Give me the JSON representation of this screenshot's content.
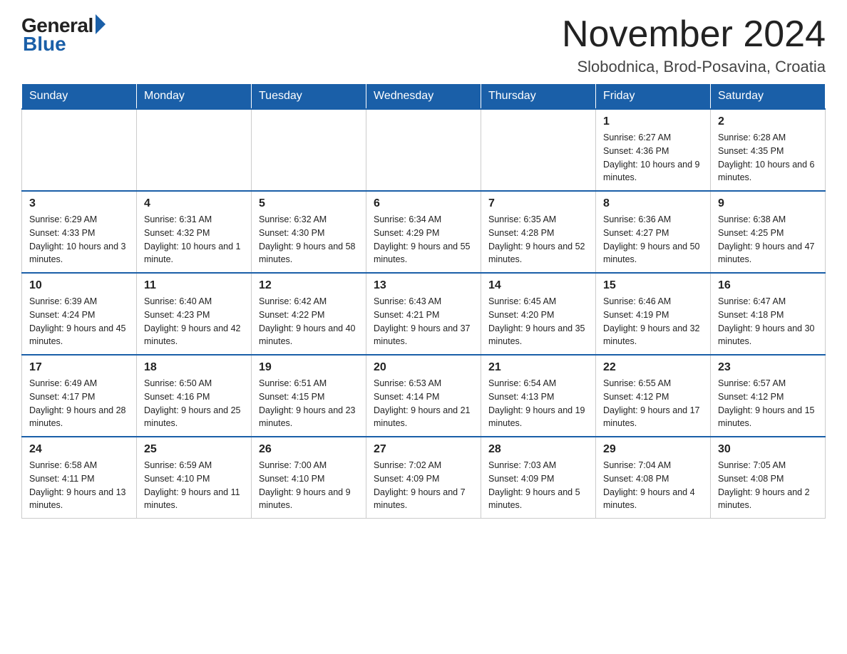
{
  "logo": {
    "general": "General",
    "blue": "Blue"
  },
  "title": "November 2024",
  "location": "Slobodnica, Brod-Posavina, Croatia",
  "days_of_week": [
    "Sunday",
    "Monday",
    "Tuesday",
    "Wednesday",
    "Thursday",
    "Friday",
    "Saturday"
  ],
  "weeks": [
    [
      {
        "day": "",
        "info": ""
      },
      {
        "day": "",
        "info": ""
      },
      {
        "day": "",
        "info": ""
      },
      {
        "day": "",
        "info": ""
      },
      {
        "day": "",
        "info": ""
      },
      {
        "day": "1",
        "info": "Sunrise: 6:27 AM\nSunset: 4:36 PM\nDaylight: 10 hours and 9 minutes."
      },
      {
        "day": "2",
        "info": "Sunrise: 6:28 AM\nSunset: 4:35 PM\nDaylight: 10 hours and 6 minutes."
      }
    ],
    [
      {
        "day": "3",
        "info": "Sunrise: 6:29 AM\nSunset: 4:33 PM\nDaylight: 10 hours and 3 minutes."
      },
      {
        "day": "4",
        "info": "Sunrise: 6:31 AM\nSunset: 4:32 PM\nDaylight: 10 hours and 1 minute."
      },
      {
        "day": "5",
        "info": "Sunrise: 6:32 AM\nSunset: 4:30 PM\nDaylight: 9 hours and 58 minutes."
      },
      {
        "day": "6",
        "info": "Sunrise: 6:34 AM\nSunset: 4:29 PM\nDaylight: 9 hours and 55 minutes."
      },
      {
        "day": "7",
        "info": "Sunrise: 6:35 AM\nSunset: 4:28 PM\nDaylight: 9 hours and 52 minutes."
      },
      {
        "day": "8",
        "info": "Sunrise: 6:36 AM\nSunset: 4:27 PM\nDaylight: 9 hours and 50 minutes."
      },
      {
        "day": "9",
        "info": "Sunrise: 6:38 AM\nSunset: 4:25 PM\nDaylight: 9 hours and 47 minutes."
      }
    ],
    [
      {
        "day": "10",
        "info": "Sunrise: 6:39 AM\nSunset: 4:24 PM\nDaylight: 9 hours and 45 minutes."
      },
      {
        "day": "11",
        "info": "Sunrise: 6:40 AM\nSunset: 4:23 PM\nDaylight: 9 hours and 42 minutes."
      },
      {
        "day": "12",
        "info": "Sunrise: 6:42 AM\nSunset: 4:22 PM\nDaylight: 9 hours and 40 minutes."
      },
      {
        "day": "13",
        "info": "Sunrise: 6:43 AM\nSunset: 4:21 PM\nDaylight: 9 hours and 37 minutes."
      },
      {
        "day": "14",
        "info": "Sunrise: 6:45 AM\nSunset: 4:20 PM\nDaylight: 9 hours and 35 minutes."
      },
      {
        "day": "15",
        "info": "Sunrise: 6:46 AM\nSunset: 4:19 PM\nDaylight: 9 hours and 32 minutes."
      },
      {
        "day": "16",
        "info": "Sunrise: 6:47 AM\nSunset: 4:18 PM\nDaylight: 9 hours and 30 minutes."
      }
    ],
    [
      {
        "day": "17",
        "info": "Sunrise: 6:49 AM\nSunset: 4:17 PM\nDaylight: 9 hours and 28 minutes."
      },
      {
        "day": "18",
        "info": "Sunrise: 6:50 AM\nSunset: 4:16 PM\nDaylight: 9 hours and 25 minutes."
      },
      {
        "day": "19",
        "info": "Sunrise: 6:51 AM\nSunset: 4:15 PM\nDaylight: 9 hours and 23 minutes."
      },
      {
        "day": "20",
        "info": "Sunrise: 6:53 AM\nSunset: 4:14 PM\nDaylight: 9 hours and 21 minutes."
      },
      {
        "day": "21",
        "info": "Sunrise: 6:54 AM\nSunset: 4:13 PM\nDaylight: 9 hours and 19 minutes."
      },
      {
        "day": "22",
        "info": "Sunrise: 6:55 AM\nSunset: 4:12 PM\nDaylight: 9 hours and 17 minutes."
      },
      {
        "day": "23",
        "info": "Sunrise: 6:57 AM\nSunset: 4:12 PM\nDaylight: 9 hours and 15 minutes."
      }
    ],
    [
      {
        "day": "24",
        "info": "Sunrise: 6:58 AM\nSunset: 4:11 PM\nDaylight: 9 hours and 13 minutes."
      },
      {
        "day": "25",
        "info": "Sunrise: 6:59 AM\nSunset: 4:10 PM\nDaylight: 9 hours and 11 minutes."
      },
      {
        "day": "26",
        "info": "Sunrise: 7:00 AM\nSunset: 4:10 PM\nDaylight: 9 hours and 9 minutes."
      },
      {
        "day": "27",
        "info": "Sunrise: 7:02 AM\nSunset: 4:09 PM\nDaylight: 9 hours and 7 minutes."
      },
      {
        "day": "28",
        "info": "Sunrise: 7:03 AM\nSunset: 4:09 PM\nDaylight: 9 hours and 5 minutes."
      },
      {
        "day": "29",
        "info": "Sunrise: 7:04 AM\nSunset: 4:08 PM\nDaylight: 9 hours and 4 minutes."
      },
      {
        "day": "30",
        "info": "Sunrise: 7:05 AM\nSunset: 4:08 PM\nDaylight: 9 hours and 2 minutes."
      }
    ]
  ]
}
